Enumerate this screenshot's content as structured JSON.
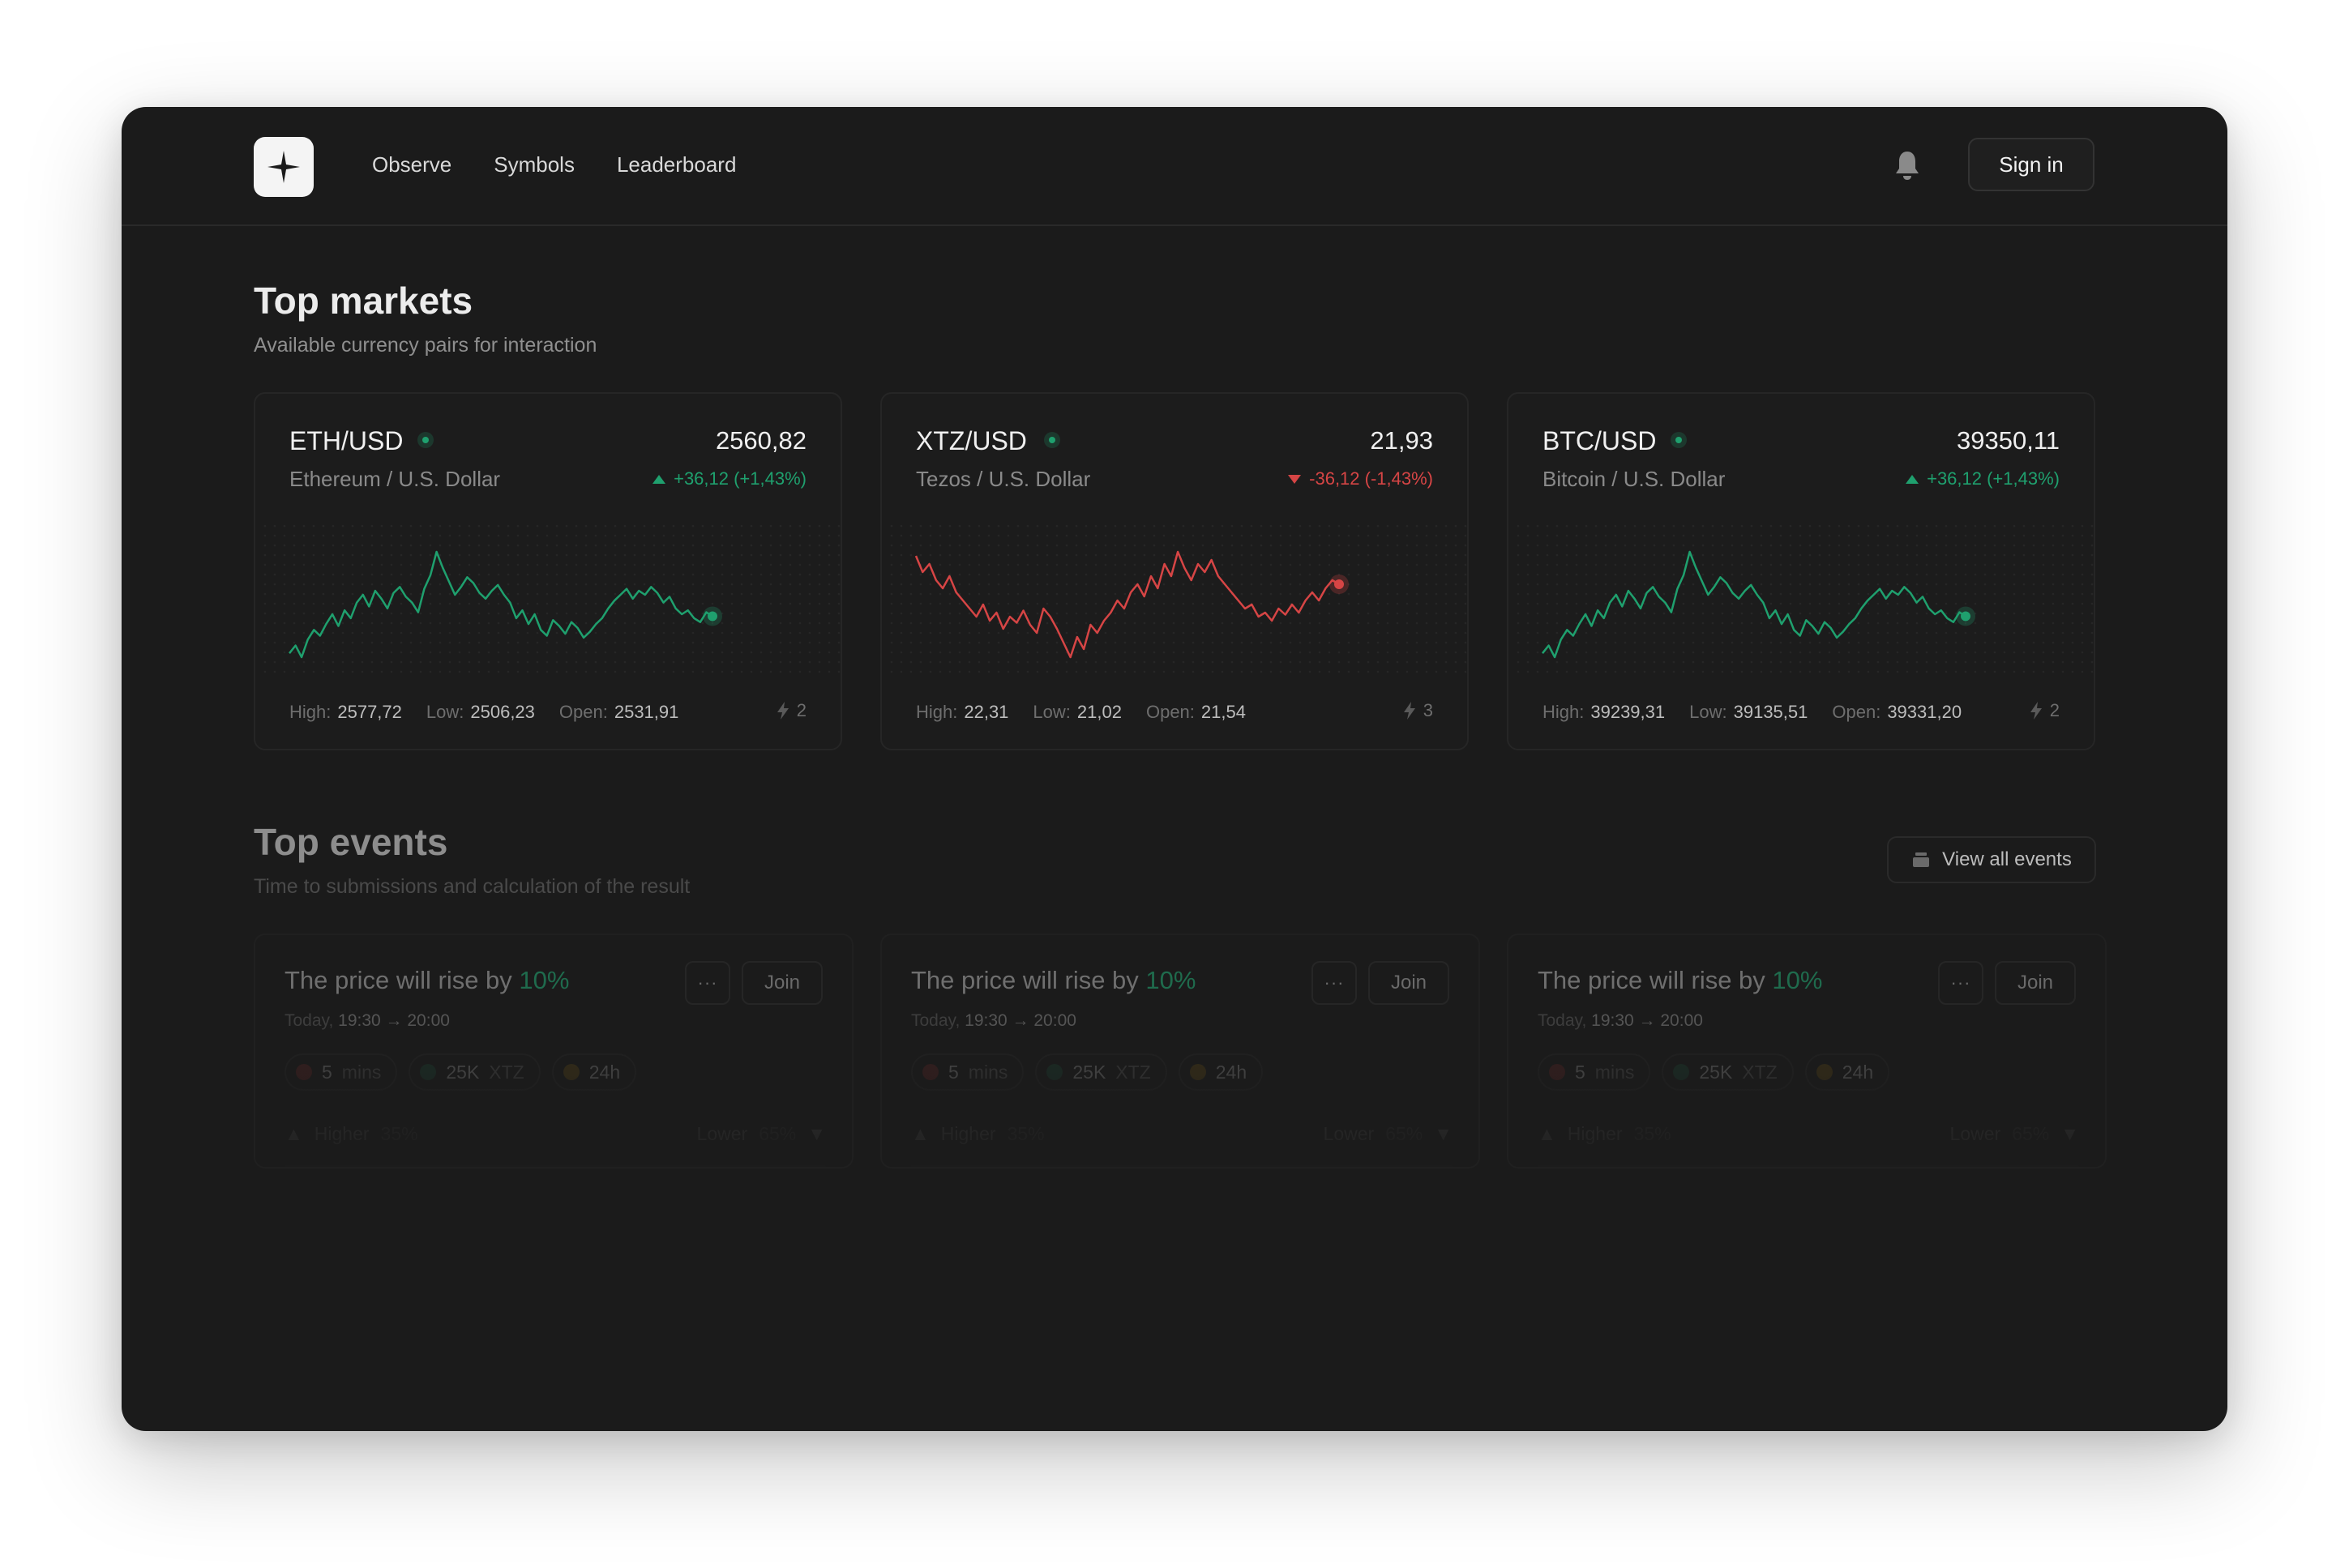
{
  "nav": {
    "links": [
      "Observe",
      "Symbols",
      "Leaderboard"
    ],
    "signin_label": "Sign in"
  },
  "markets": {
    "title": "Top markets",
    "subtitle": "Available currency pairs for interaction",
    "cards": [
      {
        "pair": "ETH/USD",
        "name": "Ethereum / U.S. Dollar",
        "price": "2560,82",
        "change": "+36,12 (+1,43%)",
        "direction": "up",
        "high_label": "High:",
        "high": "2577,72",
        "low_label": "Low:",
        "low": "2506,23",
        "open_label": "Open:",
        "open": "2531,91",
        "count": "2",
        "color": "#1fa06e",
        "series": [
          40,
          44,
          38,
          47,
          52,
          49,
          55,
          60,
          54,
          62,
          58,
          66,
          70,
          64,
          72,
          68,
          63,
          71,
          74,
          69,
          66,
          61,
          73,
          80,
          92,
          84,
          77,
          70,
          74,
          79,
          76,
          71,
          68,
          72,
          75,
          70,
          66,
          58,
          62,
          55,
          60,
          52,
          49,
          57,
          54,
          50,
          56,
          53,
          48,
          51,
          55,
          58,
          63,
          67,
          70,
          73,
          68,
          72,
          70,
          74,
          71,
          66,
          69,
          63,
          60,
          62,
          58,
          56,
          61,
          59
        ]
      },
      {
        "pair": "XTZ/USD",
        "name": "Tezos / U.S. Dollar",
        "price": "21,93",
        "change": "-36,12 (-1,43%)",
        "direction": "down",
        "high_label": "High:",
        "high": "22,31",
        "low_label": "Low:",
        "low": "21,02",
        "open_label": "Open:",
        "open": "21,54",
        "count": "3",
        "color": "#d64545",
        "series": [
          88,
          80,
          84,
          76,
          72,
          78,
          70,
          66,
          62,
          58,
          64,
          56,
          60,
          52,
          58,
          55,
          61,
          54,
          50,
          62,
          58,
          52,
          45,
          38,
          48,
          42,
          54,
          50,
          56,
          60,
          66,
          62,
          70,
          74,
          68,
          78,
          72,
          84,
          78,
          90,
          82,
          76,
          84,
          80,
          86,
          78,
          74,
          70,
          66,
          62,
          64,
          58,
          60,
          56,
          62,
          59,
          64,
          60,
          66,
          70,
          66,
          72,
          76,
          74
        ]
      },
      {
        "pair": "BTC/USD",
        "name": "Bitcoin / U.S. Dollar",
        "price": "39350,11",
        "change": "+36,12 (+1,43%)",
        "direction": "up",
        "high_label": "High:",
        "high": "39239,31",
        "low_label": "Low:",
        "low": "39135,51",
        "open_label": "Open:",
        "open": "39331,20",
        "count": "2",
        "color": "#1fa06e",
        "series": [
          40,
          44,
          38,
          47,
          52,
          49,
          55,
          60,
          54,
          62,
          58,
          66,
          70,
          64,
          72,
          68,
          63,
          71,
          74,
          69,
          66,
          61,
          73,
          80,
          92,
          84,
          77,
          70,
          74,
          79,
          76,
          71,
          68,
          72,
          75,
          70,
          66,
          58,
          62,
          55,
          60,
          52,
          49,
          57,
          54,
          50,
          56,
          53,
          48,
          51,
          55,
          58,
          63,
          67,
          70,
          73,
          68,
          72,
          70,
          74,
          71,
          66,
          69,
          63,
          60,
          62,
          58,
          56,
          61,
          59
        ]
      }
    ]
  },
  "events": {
    "title": "Top events",
    "subtitle": "Time to submissions and calculation of the result",
    "view_all_label": "View all events",
    "cards": [
      {
        "title_prefix": "The price will rise by ",
        "title_pct": "10%",
        "time_prefix": "Today, ",
        "time_range": "19:30 → 20:00",
        "chip_time": "5",
        "chip_time_unit": "mins",
        "chip_amount": "25K",
        "chip_amount_unit": "XTZ",
        "chip_duration": "24h",
        "more_label": "···",
        "join_label": "Join",
        "higher_label": "Higher",
        "higher_pct": "35%",
        "lower_label": "Lower",
        "lower_pct": "65%"
      },
      {
        "title_prefix": "The price will rise by ",
        "title_pct": "10%",
        "time_prefix": "Today, ",
        "time_range": "19:30 → 20:00",
        "chip_time": "5",
        "chip_time_unit": "mins",
        "chip_amount": "25K",
        "chip_amount_unit": "XTZ",
        "chip_duration": "24h",
        "more_label": "···",
        "join_label": "Join",
        "higher_label": "Higher",
        "higher_pct": "35%",
        "lower_label": "Lower",
        "lower_pct": "65%"
      },
      {
        "title_prefix": "The price will rise by ",
        "title_pct": "10%",
        "time_prefix": "Today, ",
        "time_range": "19:30 → 20:00",
        "chip_time": "5",
        "chip_time_unit": "mins",
        "chip_amount": "25K",
        "chip_amount_unit": "XTZ",
        "chip_duration": "24h",
        "more_label": "···",
        "join_label": "Join",
        "higher_label": "Higher",
        "higher_pct": "35%",
        "lower_label": "Lower",
        "lower_pct": "65%"
      }
    ]
  }
}
